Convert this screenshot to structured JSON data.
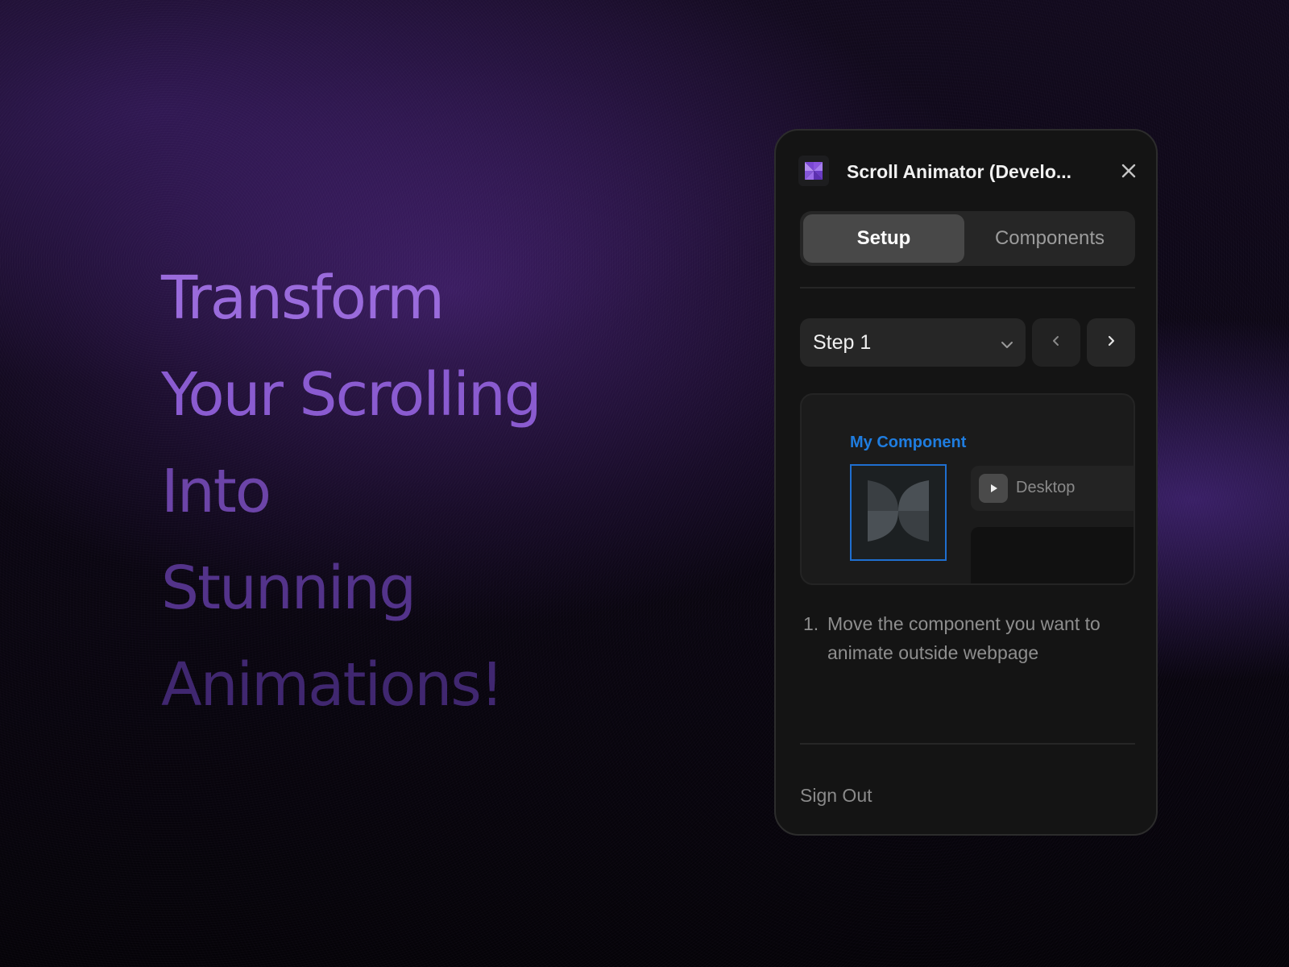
{
  "hero": {
    "lines": [
      "Transform",
      "Your Scrolling",
      "Into",
      "Stunning",
      "Animations!"
    ]
  },
  "panel": {
    "app_icon": "pinwheel-logo-icon",
    "title": "Scroll Animator (Develo...",
    "close_icon": "close-icon",
    "tabs": [
      {
        "label": "Setup",
        "active": true
      },
      {
        "label": "Components",
        "active": false
      }
    ],
    "step_select": {
      "value": "Step 1",
      "icon": "chevron-down-icon"
    },
    "prev_icon": "chevron-left-icon",
    "next_icon": "chevron-right-icon",
    "preview": {
      "component_label": "My Component",
      "component_icon": "pinwheel-icon",
      "frame_play_icon": "play-icon",
      "frame_name": "Desktop"
    },
    "instructions": [
      {
        "number": "1.",
        "text": "Move the component you want to animate outside webpage"
      }
    ],
    "sign_out": "Sign Out"
  },
  "colors": {
    "accent_purple": "#8a5bd0",
    "component_blue": "#1f7de0",
    "panel_bg": "#141414"
  }
}
